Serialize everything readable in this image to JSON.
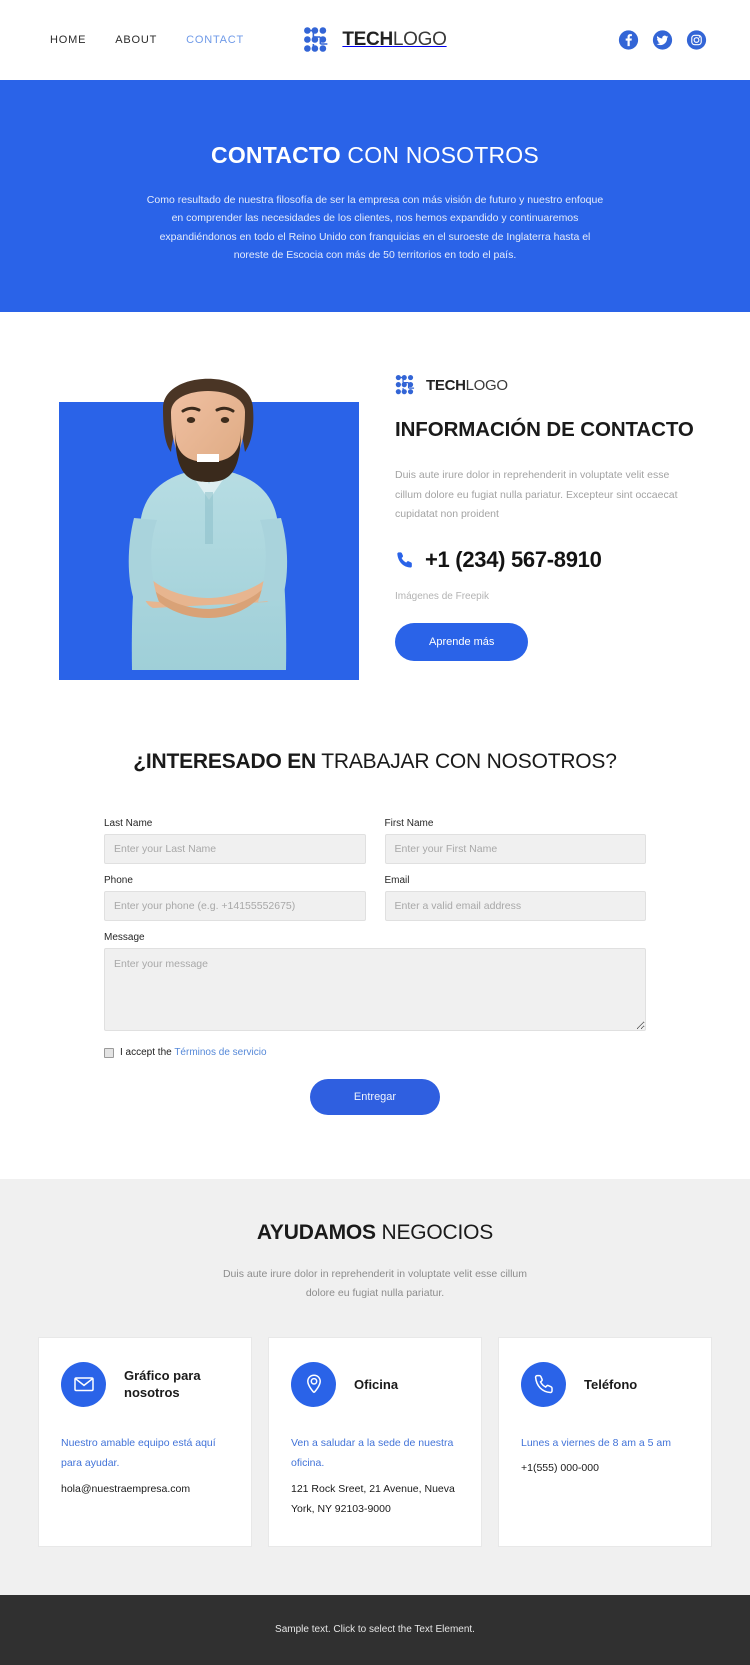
{
  "header": {
    "nav": [
      {
        "label": "HOME",
        "active": false
      },
      {
        "label": "ABOUT",
        "active": false
      },
      {
        "label": "CONTACT",
        "active": true
      }
    ],
    "logo": {
      "bold": "TECH",
      "light": "LOGO"
    },
    "socials": [
      {
        "name": "facebook-icon",
        "label": "Facebook"
      },
      {
        "name": "twitter-icon",
        "label": "Twitter"
      },
      {
        "name": "instagram-icon",
        "label": "Instagram"
      }
    ]
  },
  "hero": {
    "title_bold": "CONTACTO",
    "title_light": " CON NOSOTROS",
    "paragraph": "Como resultado de nuestra filosofía de ser la empresa con más visión de futuro y nuestro enfoque en comprender las necesidades de los clientes, nos hemos expandido y continuaremos expandiéndonos en todo el Reino Unido con franquicias en el suroeste de Inglaterra hasta el noreste de Escocia con más de 50 territorios en todo el país.",
    "background_color": "#2a63e8"
  },
  "info": {
    "logo": {
      "bold": "TECH",
      "light": "LOGO"
    },
    "title": "INFORMACIÓN DE CONTACTO",
    "paragraph": "Duis aute irure dolor in reprehenderit in voluptate velit esse cillum dolore eu fugiat nulla pariatur. Excepteur sint occaecat cupidatat non proident",
    "phone": "+1 (234) 567-8910",
    "credit_prefix": "Imágenes de",
    "credit_source": "Freepik",
    "cta_label": "Aprende más",
    "photo_alt": "Hombre sonriente con los brazos cruzados"
  },
  "form": {
    "title_bold": "¿INTERESADO EN",
    "title_light": " TRABAJAR CON NOSOTROS?",
    "fields": {
      "last_name": {
        "label": "Last Name",
        "placeholder": "Enter your Last Name",
        "value": ""
      },
      "first_name": {
        "label": "First Name",
        "placeholder": "Enter your First Name",
        "value": ""
      },
      "phone": {
        "label": "Phone",
        "placeholder": "Enter your phone (e.g. +14155552675)",
        "value": ""
      },
      "email": {
        "label": "Email",
        "placeholder": "Enter a valid email address",
        "value": ""
      },
      "message": {
        "label": "Message",
        "placeholder": "Enter your message",
        "value": ""
      }
    },
    "accept_text": "I accept the",
    "accept_link": "Términos de servicio",
    "accept_checked": false,
    "submit_label": "Entregar"
  },
  "help": {
    "title_bold": "AYUDAMOS",
    "title_light": " NEGOCIOS",
    "subtitle": "Duis aute irure dolor in reprehenderit in voluptate velit esse cillum dolore eu fugiat nulla pariatur.",
    "cards": [
      {
        "icon": "envelope-icon",
        "title": "Gráfico para nosotros",
        "lead": "Nuestro amable equipo está aquí para ayudar.",
        "detail": "hola@nuestraempresa.com"
      },
      {
        "icon": "map-pin-icon",
        "title": "Oficina",
        "lead": "Ven a saludar a la sede de nuestra oficina.",
        "detail": "121 Rock Sreet, 21 Avenue, Nueva York, NY 92103-9000"
      },
      {
        "icon": "phone-icon",
        "title": "Teléfono",
        "lead": "Lunes a viernes de 8 am a 5 am",
        "detail": "+1(555) 000-000"
      }
    ]
  },
  "footer": {
    "text": "Sample text. Click to select the Text Element.",
    "background_color": "#303030"
  },
  "theme": {
    "accent": "#2a63e8",
    "accent_dark": "#2f5fe0",
    "muted_text": "#a3a3a3",
    "section_bg": "#f0f0f0",
    "footer_bg": "#303030"
  }
}
